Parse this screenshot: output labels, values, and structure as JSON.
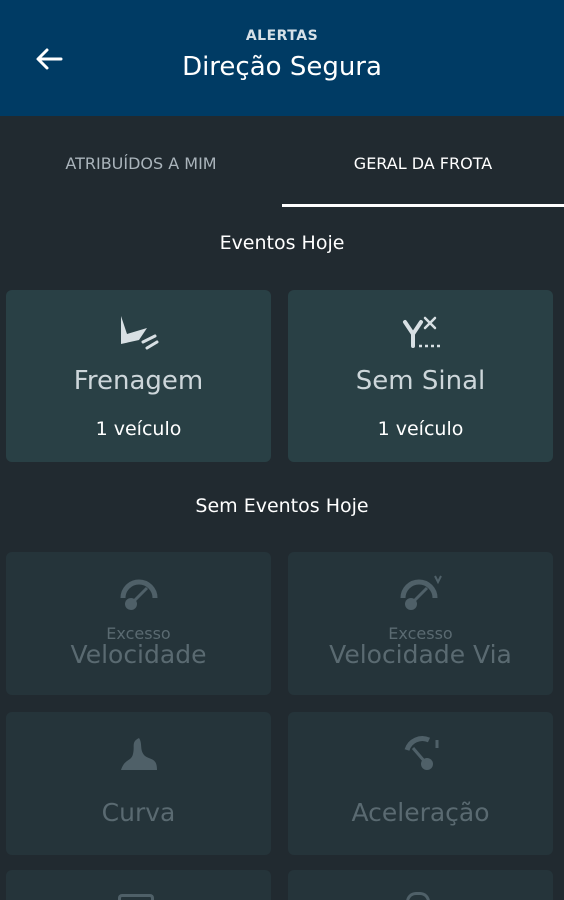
{
  "header": {
    "overline": "ALERTAS",
    "title": "Direção Segura",
    "back_icon": "arrow-left-icon",
    "background": "#003b64"
  },
  "tabs": [
    {
      "label": "ATRIBUÍDOS A MIM",
      "selected": false
    },
    {
      "label": "GERAL DA FROTA",
      "selected": true
    }
  ],
  "sections": {
    "today_events": "Eventos Hoje",
    "no_events": "Sem Eventos Hoje"
  },
  "active_cards": [
    {
      "title": "Frenagem",
      "subtitle": "1 veículo",
      "icon": "braking-icon"
    },
    {
      "title": "Sem Sinal",
      "subtitle": "1 veículo",
      "icon": "no-signal-icon"
    }
  ],
  "inactive_cards": [
    {
      "overline": "Excesso",
      "title": "Velocidade",
      "icon": "speedometer-icon"
    },
    {
      "overline": "Excesso",
      "title": "Velocidade Via",
      "icon": "road-speed-icon"
    },
    {
      "title": "Curva",
      "icon": "curve-icon"
    },
    {
      "title": "Aceleração",
      "icon": "acceleration-icon"
    }
  ],
  "colors": {
    "background": "#212a30",
    "card_active": "#294045",
    "card_inactive": "#25343a",
    "inactive_text": "#5a6a71"
  }
}
